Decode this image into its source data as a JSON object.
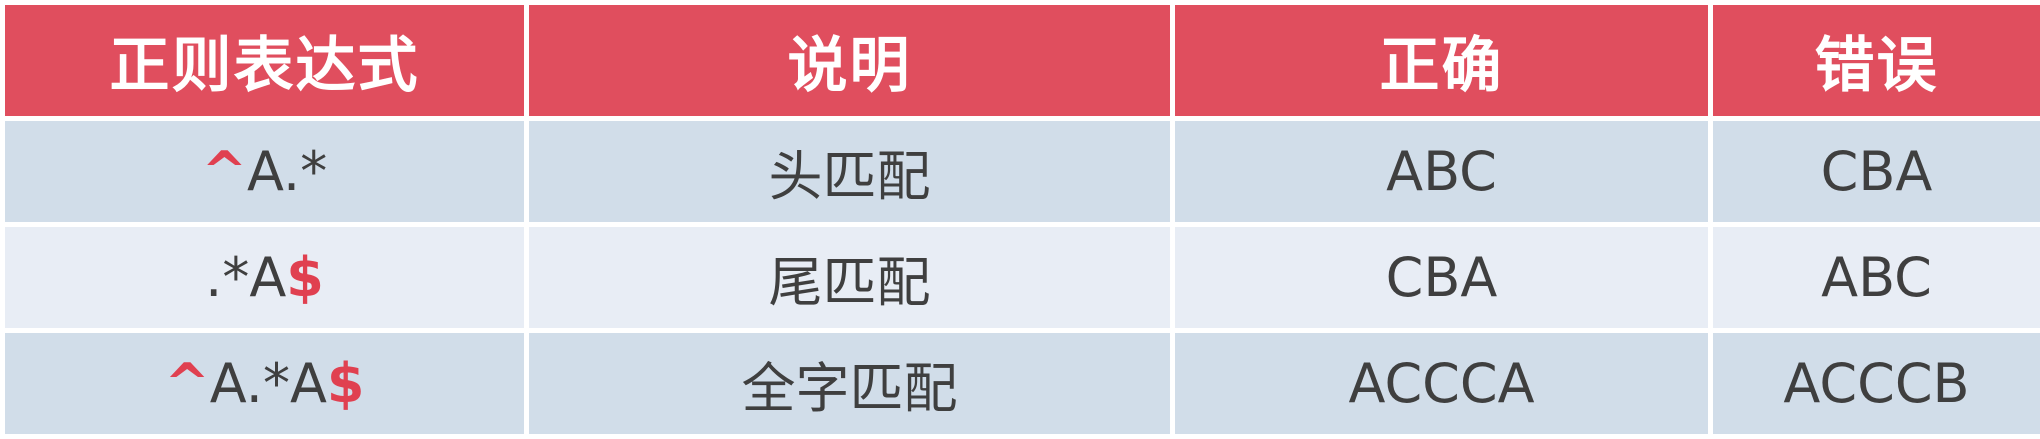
{
  "colors": {
    "header_bg": "#e04e5e",
    "header_text": "#ffffff",
    "row_odd_bg": "#d1dde9",
    "row_even_bg": "#e8edf5",
    "accent": "#e04050",
    "body_text": "#3f3f3f"
  },
  "table": {
    "headers": [
      "正则表达式",
      "说明",
      "正确",
      "错误"
    ],
    "rows": [
      {
        "regex": {
          "prefix": "^",
          "body": "A.*",
          "suffix": ""
        },
        "description": "头匹配",
        "correct": "ABC",
        "wrong": "CBA"
      },
      {
        "regex": {
          "prefix": "",
          "body": ".*A",
          "suffix": "$"
        },
        "description": "尾匹配",
        "correct": "CBA",
        "wrong": "ABC"
      },
      {
        "regex": {
          "prefix": "^",
          "body": "A.*A",
          "suffix": "$"
        },
        "description": "全字匹配",
        "correct": "ACCCA",
        "wrong": "ACCCB"
      }
    ]
  }
}
